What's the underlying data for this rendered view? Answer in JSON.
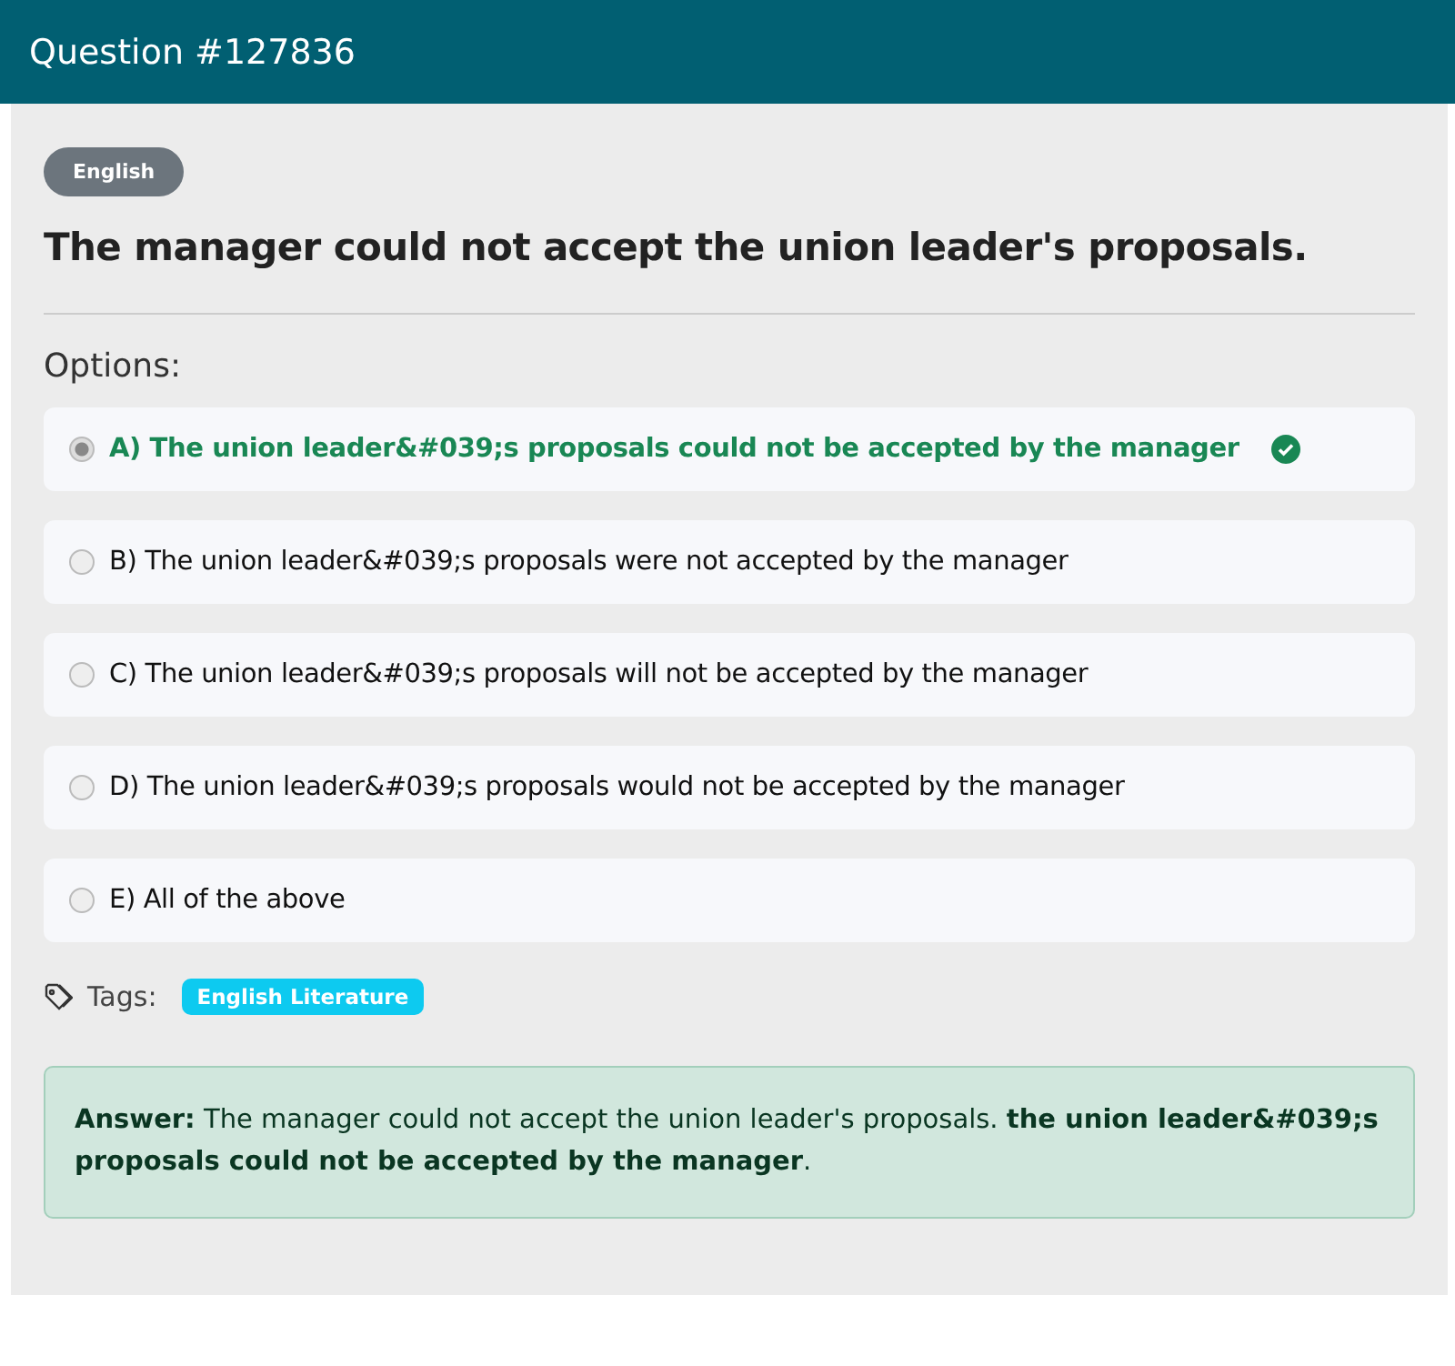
{
  "header": {
    "title": "Question #127836"
  },
  "category": "English",
  "question": "The manager could not accept the union leader's proposals.",
  "options_label": "Options:",
  "options": [
    {
      "text": "A) The union leader&#039;s proposals could not be accepted by the manager",
      "selected": true,
      "correct": true
    },
    {
      "text": "B) The union leader&#039;s proposals were not accepted by the manager",
      "selected": false,
      "correct": false
    },
    {
      "text": "C) The union leader&#039;s proposals will not be accepted by the manager",
      "selected": false,
      "correct": false
    },
    {
      "text": "D) The union leader&#039;s proposals would not be accepted by the manager",
      "selected": false,
      "correct": false
    },
    {
      "text": "E) All of the above",
      "selected": false,
      "correct": false
    }
  ],
  "tags_label": "Tags:",
  "tags": [
    "English Literature"
  ],
  "answer": "**Answer:** The manager could not accept the union leader's proposals. **the union leader&#039;s proposals could not be accepted by the manager**."
}
